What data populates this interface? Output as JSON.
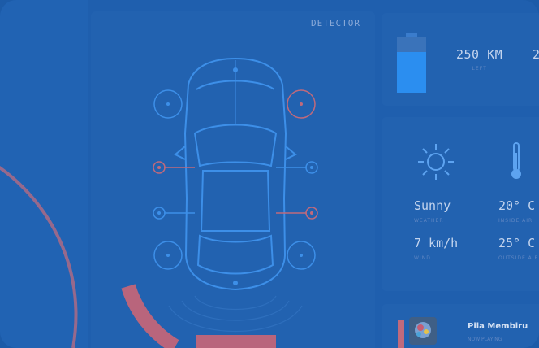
{
  "detector": {
    "title": "DETECTOR"
  },
  "battery": {
    "charge_level": 0.72,
    "range_value": "250 KM",
    "range_label": "LEFT",
    "second_value": "2"
  },
  "weather": {
    "condition": "Sunny",
    "condition_label": "WEATHER",
    "temperature_inside": "20° C",
    "temperature_inside_label": "INSIDE AIR",
    "wind": "7 km/h",
    "wind_label": "WIND",
    "temperature_outside": "25° C",
    "temperature_outside_label": "OUTSIDE AIR"
  },
  "music": {
    "title": "Pila Membiru",
    "subtitle": "NOW PLAYING"
  },
  "colors": {
    "background": "#1f5fae",
    "panel": "#2262b0",
    "line_blue": "#3d8fe8",
    "alert_pink": "#c06a7c",
    "battery_fill": "#2b8ef0"
  }
}
